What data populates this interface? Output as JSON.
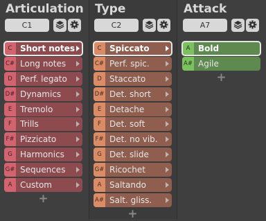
{
  "columns": [
    {
      "title": "Articulation",
      "key": "C1",
      "items": [
        {
          "key": "C",
          "label": "Short notes",
          "selected": true
        },
        {
          "key": "C#",
          "label": "Long notes"
        },
        {
          "key": "D",
          "label": "Perf. legato"
        },
        {
          "key": "D#",
          "label": "Dynamics"
        },
        {
          "key": "E",
          "label": "Tremolo"
        },
        {
          "key": "F",
          "label": "Trills"
        },
        {
          "key": "F#",
          "label": "Pizzicato"
        },
        {
          "key": "G",
          "label": "Harmonics"
        },
        {
          "key": "G#",
          "label": "Sequences"
        },
        {
          "key": "A",
          "label": "Custom"
        }
      ],
      "add_label": "+"
    },
    {
      "title": "Type",
      "key": "C2",
      "items": [
        {
          "key": "C",
          "label": "Spiccato",
          "selected": true
        },
        {
          "key": "C#",
          "label": "Perf. spic."
        },
        {
          "key": "D",
          "label": "Staccato"
        },
        {
          "key": "D#",
          "label": "Det. short"
        },
        {
          "key": "E",
          "label": "Detache"
        },
        {
          "key": "F",
          "label": "Det. soft"
        },
        {
          "key": "F#",
          "label": "Det. no vib."
        },
        {
          "key": "G",
          "label": "Det. slide"
        },
        {
          "key": "G#",
          "label": "Ricochet"
        },
        {
          "key": "A",
          "label": "Saltando"
        },
        {
          "key": "A#",
          "label": "Salt. gliss."
        }
      ],
      "add_label": "+"
    },
    {
      "title": "Attack",
      "key": "A7",
      "items": [
        {
          "key": "A",
          "label": "Bold",
          "selected": true
        },
        {
          "key": "A#",
          "label": "Agile"
        }
      ],
      "add_label": "+"
    }
  ],
  "icons": {
    "layers": "layers-icon",
    "gear": "gear-icon"
  },
  "colors": {
    "articulation_item": "#8e4b4f",
    "type_item": "#8f5e4e",
    "attack_item": "#5e8a4f"
  }
}
